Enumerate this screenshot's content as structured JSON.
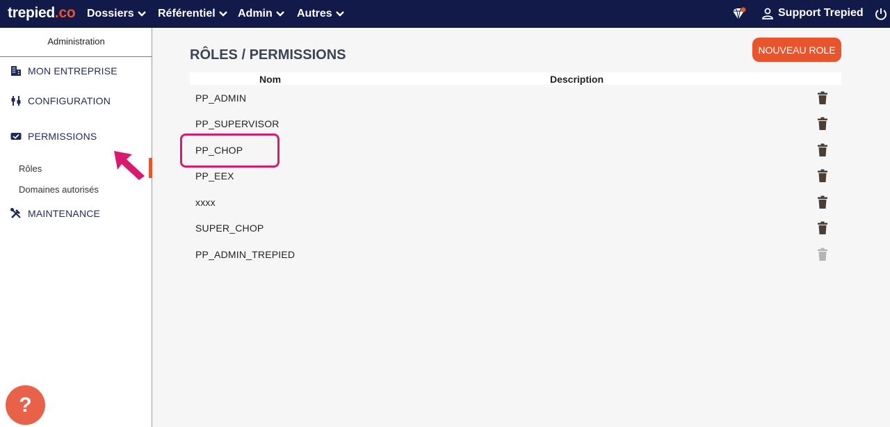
{
  "header": {
    "logo_text": "trepied",
    "logo_suffix": ".co",
    "nav": [
      "Dossiers",
      "Référentiel",
      "Admin",
      "Autres"
    ],
    "user_label": "Support Trepied"
  },
  "sidebar": {
    "title": "Administration",
    "items": [
      {
        "label": "MON ENTREPRISE",
        "icon": "building-icon"
      },
      {
        "label": "CONFIGURATION",
        "icon": "sliders-icon"
      },
      {
        "label": "PERMISSIONS",
        "icon": "permission-card-icon"
      },
      {
        "label": "MAINTENANCE",
        "icon": "tools-icon"
      }
    ],
    "subitems": [
      "Rôles",
      "Domaines autorisés"
    ]
  },
  "main": {
    "title": "RÔLES / PERMISSIONS",
    "new_button": "NOUVEAU ROLE",
    "columns": [
      "Nom",
      "Description"
    ],
    "rows": [
      {
        "name": "PP_ADMIN",
        "deletable": true
      },
      {
        "name": "PP_SUPERVISOR",
        "deletable": true
      },
      {
        "name": "PP_CHOP",
        "deletable": true
      },
      {
        "name": "PP_EEX",
        "deletable": true
      },
      {
        "name": "xxxx",
        "deletable": true
      },
      {
        "name": "SUPER_CHOP",
        "deletable": true
      },
      {
        "name": "PP_ADMIN_TREPIED",
        "deletable": false
      }
    ]
  },
  "help_label": "?",
  "colors": {
    "topbar": "#111a48",
    "accent": "#e8542c",
    "highlight": "#d9196e",
    "trash": "#4a3f36",
    "trash_disabled": "#b5b5b5"
  }
}
